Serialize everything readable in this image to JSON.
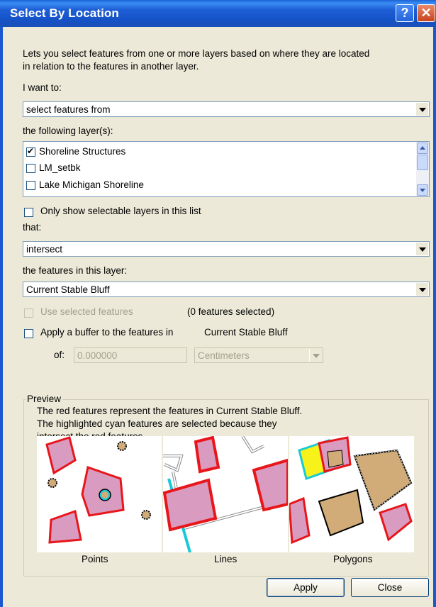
{
  "window": {
    "title": "Select By Location",
    "help": "?",
    "close": "✕"
  },
  "description": {
    "line1": "Lets you select features from one or more layers based on where they are located",
    "line2": "in relation to the features in another layer."
  },
  "method": {
    "label": "I want to:",
    "value": "select features from"
  },
  "layers": {
    "label": "the following layer(s):",
    "items": [
      {
        "label": "Shoreline Structures",
        "checked": true
      },
      {
        "label": "LM_setbk",
        "checked": false
      },
      {
        "label": "Lake Michigan Shoreline",
        "checked": false
      }
    ],
    "only_selectable_label": "Only show selectable layers in this list"
  },
  "relation": {
    "label": "that:",
    "value": "intersect"
  },
  "source": {
    "label": "the features in this layer:",
    "value": "Current Stable Bluff"
  },
  "use_selected": {
    "label": "Use selected features",
    "count_text": "(0 features selected)"
  },
  "buffer": {
    "label": "Apply a buffer to the features in",
    "layer": "Current Stable Bluff",
    "of_label": "of:",
    "value": "0.000000",
    "units": "Centimeters"
  },
  "preview": {
    "legend": "Preview",
    "line1": "The red features represent the features in Current Stable Bluff.",
    "line2": "The highlighted cyan features are selected because they",
    "line3": "intersect the red features.",
    "captions": [
      "Points",
      "Lines",
      "Polygons"
    ]
  },
  "buttons": {
    "apply": "Apply",
    "close": "Close"
  },
  "colors": {
    "title_bar": "#1f5fd6",
    "dialog_bg": "#ece9d8",
    "feature_red": "#e8161b",
    "feature_fill": "#d99bbf",
    "selected_cyan": "#18c9d6",
    "highlight_yellow": "#f7f21a",
    "point_tan": "#d2ac78"
  }
}
